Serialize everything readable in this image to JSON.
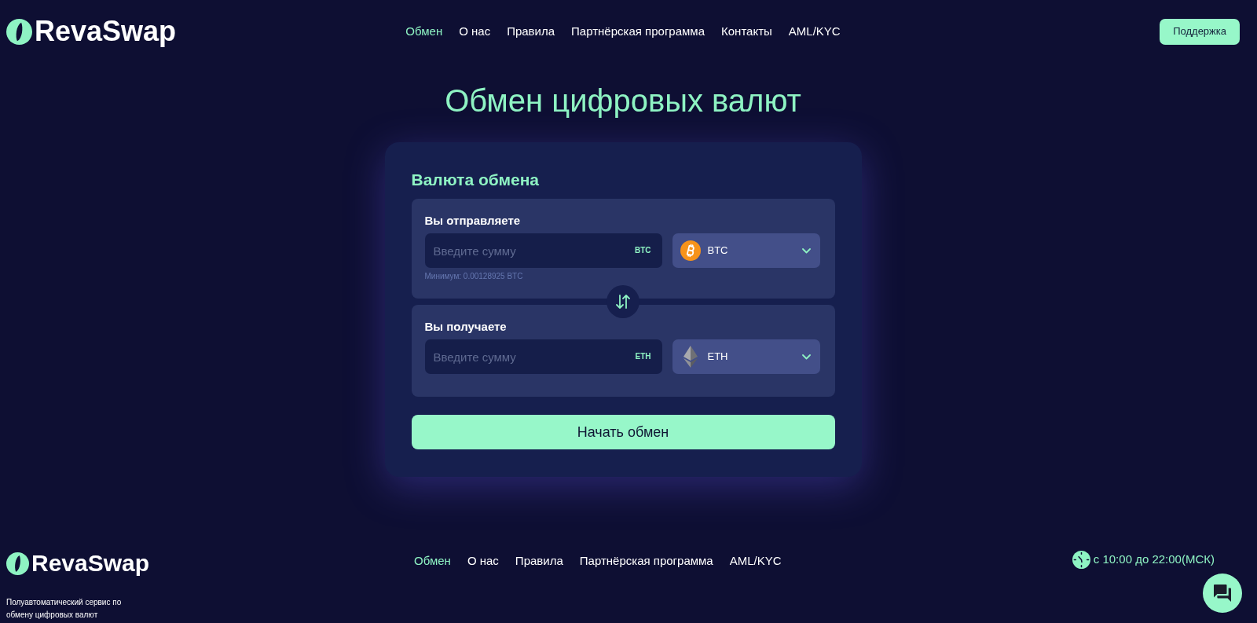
{
  "header": {
    "logo": "RevaSwap",
    "nav": [
      {
        "label": "Обмен",
        "selected": true
      },
      {
        "label": "О нас",
        "selected": false
      },
      {
        "label": "Правила",
        "selected": false
      },
      {
        "label": "Партнёрская программа",
        "selected": false
      },
      {
        "label": "Контакты",
        "selected": false
      },
      {
        "label": "AML/KYC",
        "selected": false
      }
    ],
    "support_button": "Поддержка"
  },
  "title": "Обмен цифровых валют",
  "exchange_form": {
    "title": "Валюта обмена",
    "sections": [
      {
        "label": "Вы отправляете",
        "amount": {
          "placeholder": "Введите сумму",
          "unit": "BTC"
        },
        "currency": {
          "code": "BTC",
          "kind": "bitcoin"
        },
        "hint": "Минимум: 0.00128925 BTC"
      },
      {
        "label": "Вы получаете",
        "amount": {
          "placeholder": "Введите сумму",
          "unit": "ETH"
        },
        "currency": {
          "code": "ETH",
          "kind": "ethereum"
        }
      }
    ],
    "submit_button": "Начать обмен"
  },
  "footer": {
    "logo": "RevaSwap",
    "nav": [
      {
        "label": "Обмен",
        "selected": true
      },
      {
        "label": "О нас",
        "selected": false
      },
      {
        "label": "Правила",
        "selected": false
      },
      {
        "label": "Партнёрская программа",
        "selected": false
      },
      {
        "label": "AML/KYC",
        "selected": false
      }
    ],
    "tagline": "Полуавтоматический сервис по обмену цифровых валют",
    "hours": "с 10:00 до 22:00(МСК)"
  }
}
